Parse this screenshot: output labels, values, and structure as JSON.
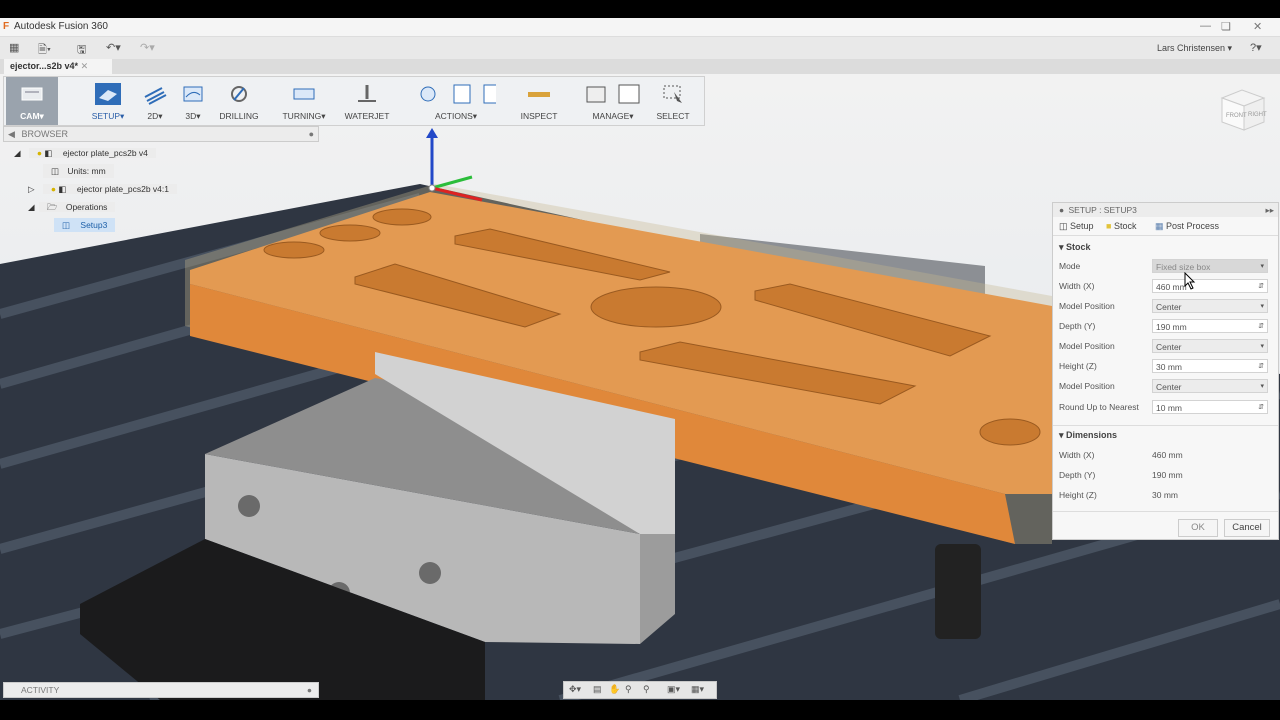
{
  "app": {
    "title": "Autodesk Fusion 360",
    "user": "Lars Christensen",
    "help": "?"
  },
  "document_tab": "ejector...s2b v4*",
  "toolbar": {
    "workspace": "CAM",
    "groups": [
      "SETUP",
      "2D",
      "3D",
      "DRILLING",
      "TURNING",
      "WATERJET",
      "ACTIONS",
      "INSPECT",
      "MANAGE",
      "SELECT"
    ]
  },
  "browser": {
    "header": "BROWSER",
    "root": "ejector plate_pcs2b v4",
    "units": "Units: mm",
    "component": "ejector plate_pcs2b v4:1",
    "operations": "Operations",
    "setup": "Setup3"
  },
  "activity": "ACTIVITY",
  "panel": {
    "title": "SETUP : SETUP3",
    "tabs": [
      "Setup",
      "Stock",
      "Post Process"
    ],
    "stock_section": "Stock",
    "fields": [
      {
        "label": "Mode",
        "value": "Fixed size box",
        "type": "select"
      },
      {
        "label": "Width (X)",
        "value": "460 mm",
        "type": "spin"
      },
      {
        "label": "Model Position",
        "value": "Center",
        "type": "select"
      },
      {
        "label": "Depth (Y)",
        "value": "190 mm",
        "type": "spin"
      },
      {
        "label": "Model Position",
        "value": "Center",
        "type": "select"
      },
      {
        "label": "Height (Z)",
        "value": "30 mm",
        "type": "spin"
      },
      {
        "label": "Model Position",
        "value": "Center",
        "type": "select"
      },
      {
        "label": "Round Up to Nearest",
        "value": "10 mm",
        "type": "spin"
      }
    ],
    "dimensions_section": "Dimensions",
    "dimensions": [
      {
        "label": "Width (X)",
        "value": "460 mm"
      },
      {
        "label": "Depth (Y)",
        "value": "190 mm"
      },
      {
        "label": "Height (Z)",
        "value": "30 mm"
      }
    ],
    "ok": "OK",
    "cancel": "Cancel"
  },
  "viewcube": {
    "front": "FRONT",
    "right": "RIGHT"
  },
  "colors": {
    "part": "#e08a3c",
    "vise": "#9a9a9a",
    "table": "#2d3440",
    "accent": "#3a78c0"
  }
}
